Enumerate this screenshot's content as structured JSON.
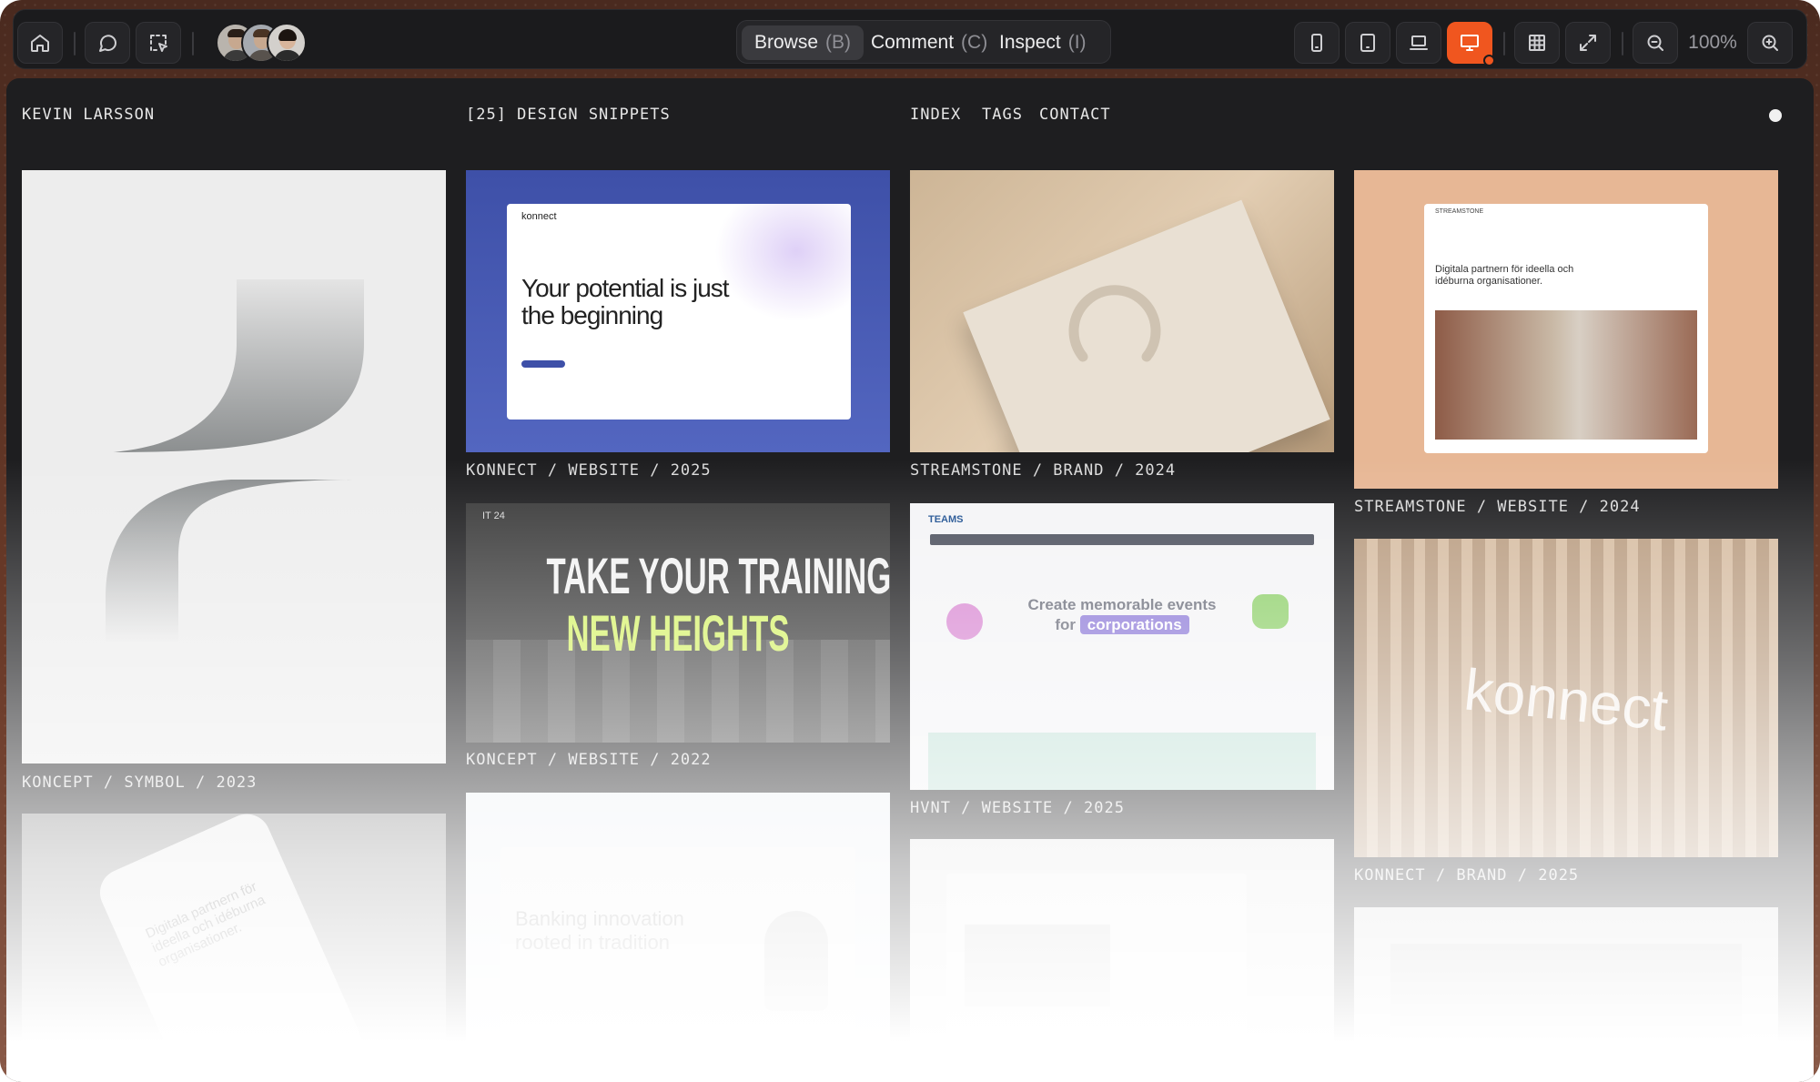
{
  "toolbar": {
    "home": "home-icon",
    "comment": "comment-icon",
    "select": "select-icon",
    "modes": [
      {
        "label": "Browse",
        "key": "(B)"
      },
      {
        "label": "Comment",
        "key": "(C)"
      },
      {
        "label": "Inspect",
        "key": "(I)"
      }
    ],
    "active_mode": "Browse",
    "devices": [
      "phone-icon",
      "tablet-icon",
      "laptop-icon",
      "desktop-icon"
    ],
    "active_device": "desktop-icon",
    "grid": "grid-icon",
    "expand": "expand-icon",
    "zoom_out": "zoom-out-icon",
    "zoom_level": "100%",
    "zoom_in": "zoom-in-icon",
    "accent_color": "#f0561f"
  },
  "site": {
    "author": "KEVIN LARSSON",
    "count": "[25] DESIGN SNIPPETS",
    "nav": [
      "INDEX",
      "TAGS",
      "CONTACT"
    ]
  },
  "thumbs": {
    "konnect_headline": "Your potential is just the beginning",
    "konnect_logo": "konnect",
    "stream_site_headline": "Digitala partnern för ideella och idéburna organisationer.",
    "stream_site_logo": "STREAMSTONE",
    "gym_headline_1": "TAKE YOUR TRAINING TO",
    "gym_headline_2": "NEW HEIGHTS",
    "gym_logo": "IT 24",
    "teams_logo": "TEAMS",
    "teams_headline_1": "Create memorable events",
    "teams_headline_2": "for",
    "teams_headline_pill": "corporations",
    "wood_logo": "konnect",
    "phone_text": "Digitala partnern för ideella och idéburna organisationer.",
    "bank_headline": "Banking innovation rooted in tradition"
  },
  "cards": [
    {
      "caption": "KONCEPT / SYMBOL / 2023"
    },
    {
      "caption": "KONNECT / WEBSITE / 2025"
    },
    {
      "caption": "STREAMSTONE / BRAND / 2024"
    },
    {
      "caption": "STREAMSTONE / WEBSITE / 2024"
    },
    {
      "caption": "KONCEPT / WEBSITE / 2022"
    },
    {
      "caption": "HVNT / WEBSITE / 2025"
    },
    {
      "caption": "KONNECT / BRAND / 2025"
    }
  ]
}
